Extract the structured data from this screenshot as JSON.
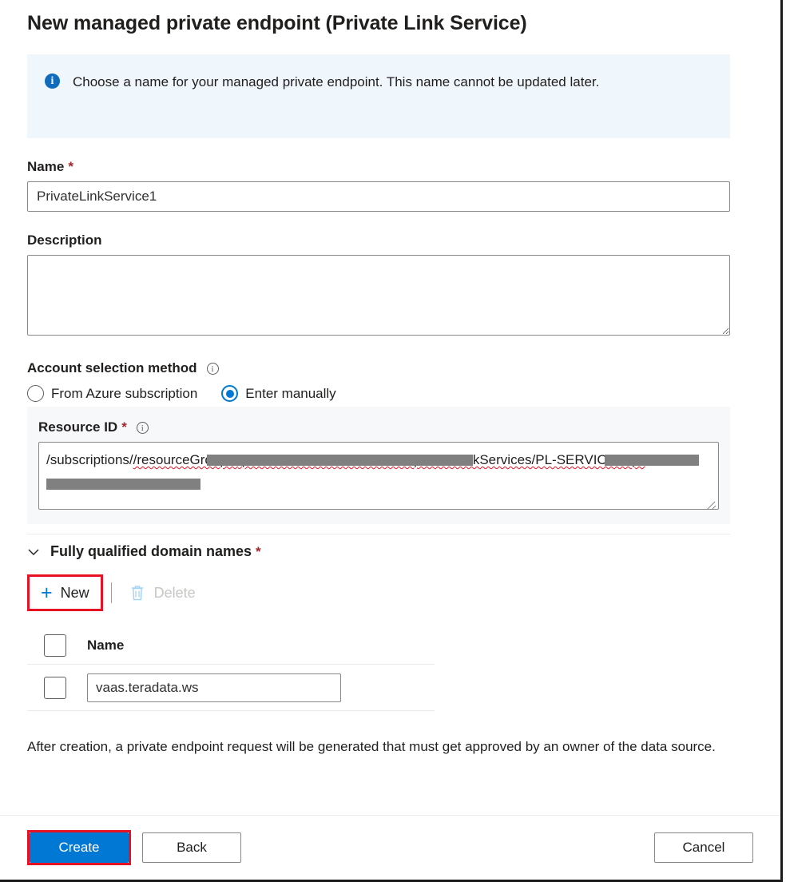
{
  "page": {
    "title": "New managed private endpoint (Private Link Service)"
  },
  "info_banner": {
    "icon": "info-icon",
    "message": "Choose a name for your managed private endpoint. This name cannot be updated later."
  },
  "name_field": {
    "label": "Name",
    "required_marker": "*",
    "value": "PrivateLinkService1"
  },
  "description_field": {
    "label": "Description",
    "value": ""
  },
  "account_selection": {
    "label": "Account selection method",
    "info_icon": "info-circle-icon",
    "options": [
      {
        "label": "From Azure subscription",
        "selected": false
      },
      {
        "label": "Enter manually",
        "selected": true
      }
    ]
  },
  "resource_id": {
    "label": "Resource ID",
    "required_marker": "*",
    "info_icon": "info-circle-icon",
    "value_part_1": "/subscriptions/",
    "value_redacted_1": "",
    "value_part_2": "/resourceGroups/",
    "value_redacted_2": "",
    "value_part_3": "/providers/Microsoft.Network/privateLinkServices/PL-SERVICE-sqle"
  },
  "fqdn_section": {
    "chevron": "chevron-down-icon",
    "title": "Fully qualified domain names",
    "required_marker": "*",
    "commands": {
      "new_label": "New",
      "new_icon": "plus-icon",
      "delete_label": "Delete",
      "delete_icon": "trash-icon",
      "delete_disabled": true
    },
    "table": {
      "header": "Name",
      "rows": [
        {
          "value": "vaas.teradata.ws",
          "checked": false
        }
      ]
    }
  },
  "footnote": "After creation, a private endpoint request will be generated that must get approved by an owner of the data source.",
  "actions": {
    "create_label": "Create",
    "back_label": "Back",
    "cancel_label": "Cancel"
  },
  "colors": {
    "accent": "#0078d4",
    "highlight_outline": "#e81123",
    "info_banner_bg": "#eff6fc",
    "required_star": "#a4262c",
    "panel_bg": "#f7f8fa"
  }
}
